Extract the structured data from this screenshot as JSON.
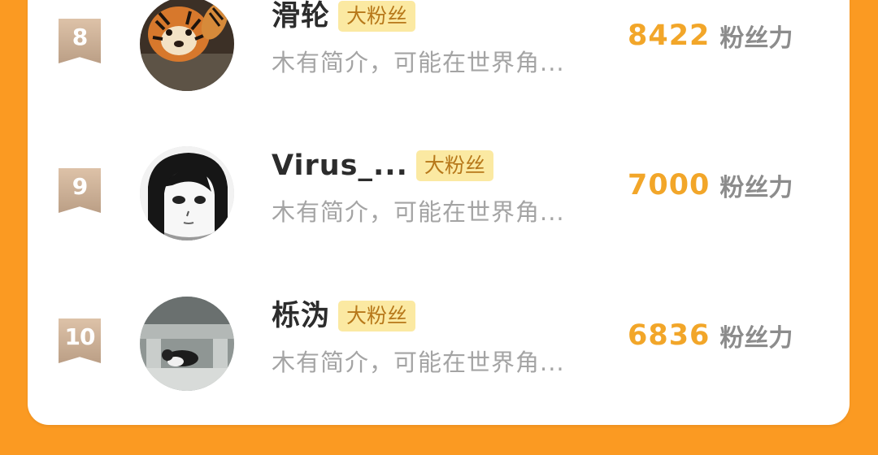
{
  "rank_list": [
    {
      "rank": "8",
      "name": "滑轮",
      "badge": "大粉丝",
      "intro": "木有简介，可能在世界角...",
      "score": "8422",
      "score_unit": "粉丝力",
      "avatar_icon": "tiger-avatar-icon"
    },
    {
      "rank": "9",
      "name": "Virus_...",
      "badge": "大粉丝",
      "intro": "木有简介，可能在世界角...",
      "score": "7000",
      "score_unit": "粉丝力",
      "avatar_icon": "anime-girl-avatar-icon"
    },
    {
      "rank": "10",
      "name": "栎沩",
      "badge": "大粉丝",
      "intro": "木有简介，可能在世界角...",
      "score": "6836",
      "score_unit": "粉丝力",
      "avatar_icon": "cat-photo-avatar-icon"
    }
  ],
  "colors": {
    "background": "#fb9a22",
    "score": "#f2a629",
    "badge_bg": "#fbe9a2",
    "badge_text": "#b7781a",
    "rank_badge": "#c9ad93"
  }
}
